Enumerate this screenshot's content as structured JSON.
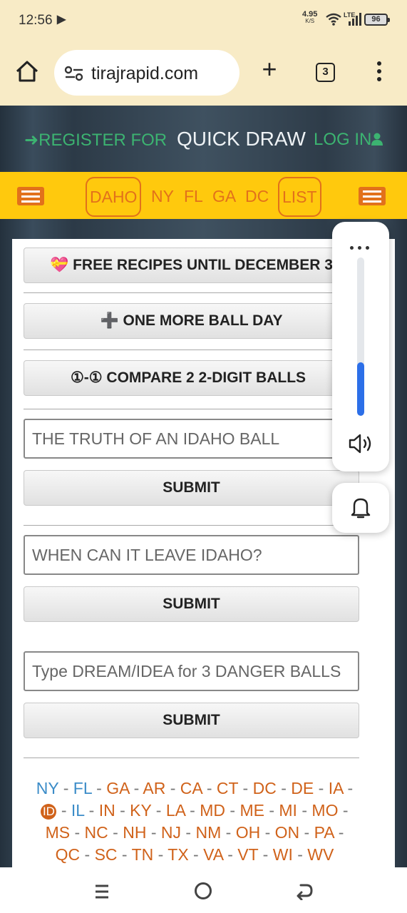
{
  "status_bar": {
    "time": "12:56",
    "net_speed_value": "4.95",
    "net_speed_unit": "K/S",
    "network": "LTE",
    "battery": "96"
  },
  "browser": {
    "url": "tirajrapid.com",
    "tab_count": "3"
  },
  "site_header": {
    "register": "REGISTER FOR",
    "title": "QUICK DRAW",
    "login": "LOG IN"
  },
  "nav": {
    "first": "DAHO",
    "states": [
      "NY",
      "FL",
      "GA",
      "DC"
    ],
    "last": "LIST"
  },
  "buttons": {
    "free_recipes": "FREE RECIPES UNTIL DECEMBER 3",
    "one_more_ball": "ONE MORE BALL DAY",
    "compare": "①-① COMPARE 2 2-DIGIT BALLS",
    "submit_1": "SUBMIT",
    "submit_2": "SUBMIT",
    "submit_3": "SUBMIT"
  },
  "fields": {
    "truth_placeholder": "THE TRUTH OF AN IDAHO BALL",
    "leave_placeholder": "WHEN CAN IT LEAVE IDAHO?",
    "dream_placeholder": "Type DREAM/IDEA for 3 DANGER BALLS"
  },
  "states_list": {
    "line1": [
      "NY",
      "FL",
      "GA",
      "AR",
      "CA",
      "CT",
      "DC",
      "DE",
      "IA"
    ],
    "current": "ID",
    "line2": [
      "IL",
      "IN",
      "KY",
      "LA",
      "MD",
      "ME",
      "MI",
      "MO"
    ],
    "line3": [
      "MS",
      "NC",
      "NH",
      "NJ",
      "NM",
      "OH",
      "ON",
      "PA"
    ],
    "line4": [
      "QC",
      "SC",
      "TN",
      "TX",
      "VA",
      "VT",
      "WI",
      "WV"
    ]
  },
  "volume": {
    "level": 0.34
  },
  "colors": {
    "accent_orange": "#e2711b",
    "nav_yellow": "#ffc90d",
    "login_green": "#3cb371",
    "link_blue": "#3b8cc8",
    "volume_blue": "#2c6fe8"
  }
}
